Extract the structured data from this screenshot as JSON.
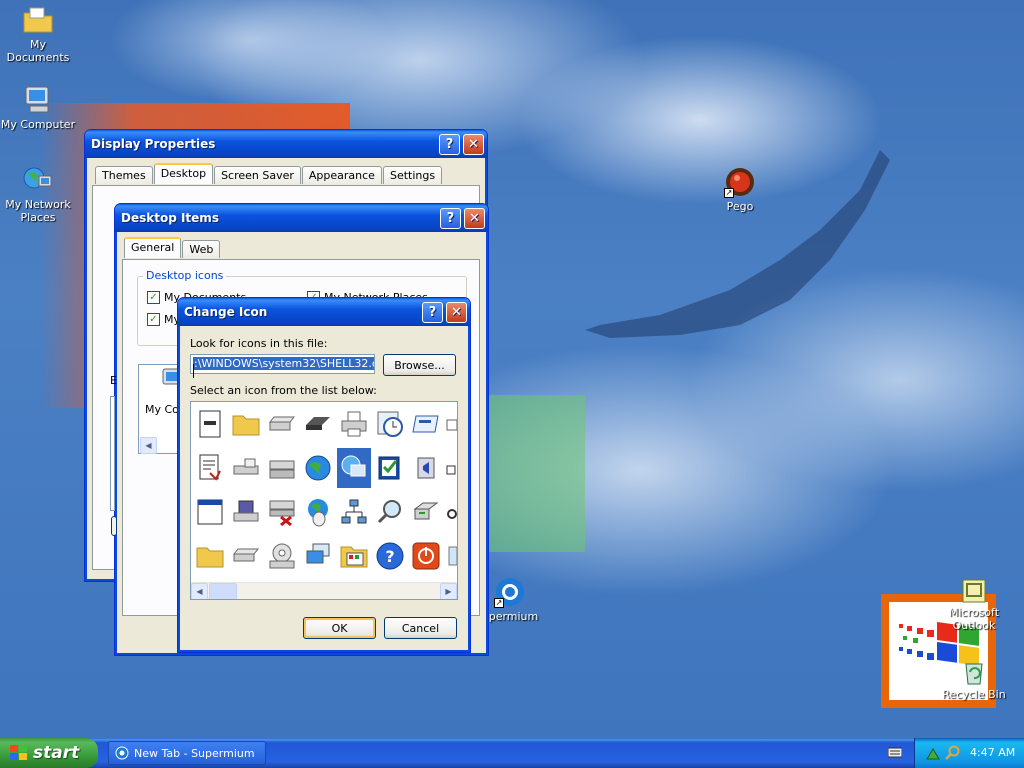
{
  "desktop_icons": [
    {
      "name": "my-documents",
      "label": "My Documents"
    },
    {
      "name": "my-computer",
      "label": "My Computer"
    },
    {
      "name": "my-network-places",
      "label": "My Network Places"
    },
    {
      "name": "pego",
      "label": "Pego"
    },
    {
      "name": "supermium",
      "label": "upermium"
    },
    {
      "name": "microsoft-outlook",
      "label": "Microsoft Outlook"
    },
    {
      "name": "recycle-bin",
      "label": "Recycle Bin"
    }
  ],
  "display_properties": {
    "title": "Display Properties",
    "tabs": [
      "Themes",
      "Desktop",
      "Screen Saver",
      "Appearance",
      "Settings"
    ],
    "active_tab": "Desktop"
  },
  "desktop_items": {
    "title": "Desktop Items",
    "tabs": [
      "General",
      "Web"
    ],
    "active_tab": "General",
    "group_label": "Desktop icons",
    "checkboxes": [
      {
        "label": "My Documents",
        "checked": true
      },
      {
        "label": "My Network Places",
        "checked": true
      },
      {
        "label": "My",
        "checked": true
      }
    ],
    "partial_label_b": "E",
    "partial_list_label": "My Co"
  },
  "change_icon": {
    "title": "Change Icon",
    "file_label": "Look for icons in this file:",
    "file_value": ":\\WINDOWS\\system32\\SHELL32.dll",
    "browse_label": "Browse...",
    "list_label": "Select an icon from the list below:",
    "ok_label": "OK",
    "cancel_label": "Cancel",
    "selected_icon": "network-monitor-icon"
  },
  "taskbar": {
    "start_label": "start",
    "task_label": "New Tab - Supermium",
    "clock": "4:47 AM"
  },
  "colors": {
    "xp_blue": "#0a54df",
    "start_green": "#3a9c3a",
    "selection": "#316ac5"
  }
}
